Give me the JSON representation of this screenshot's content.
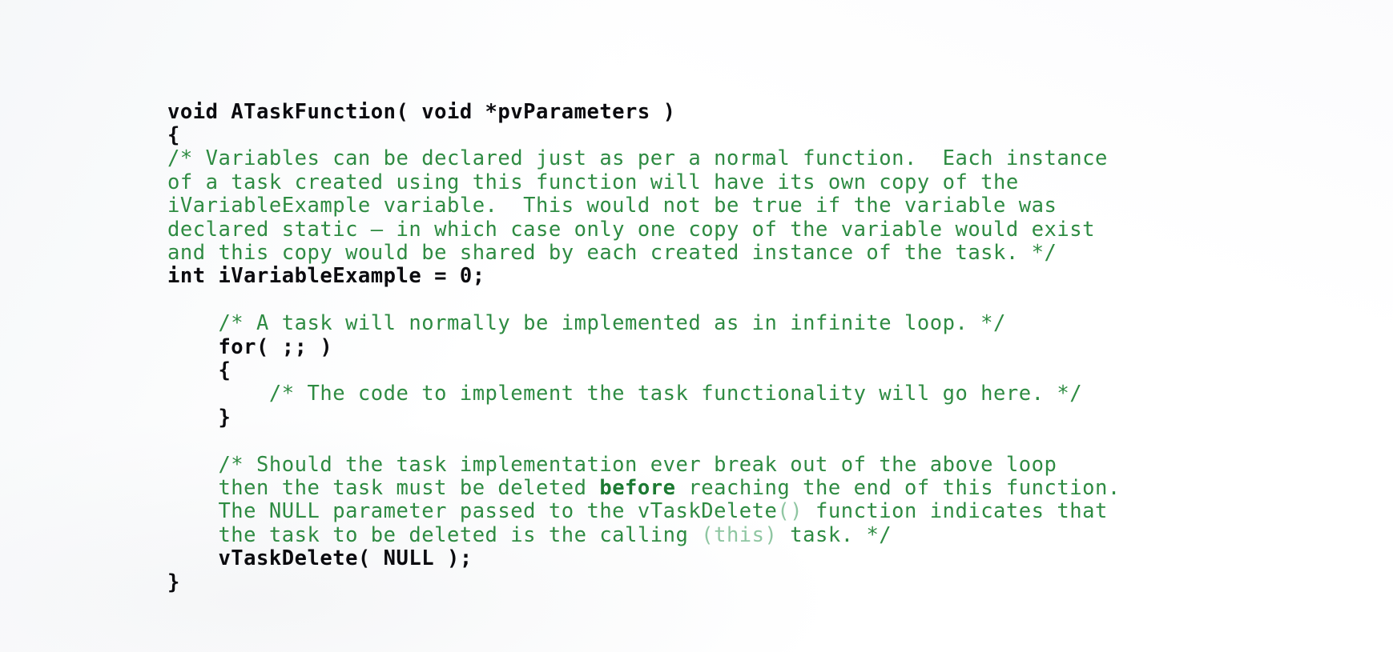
{
  "document": {
    "kind": "code-listing",
    "language": "C",
    "function_name": "ATaskFunction",
    "background_color": "#ffffff",
    "comment_color": "#2e8b42",
    "code_color": "#0b0b0f",
    "dim_comment_color": "#8fc6a2"
  },
  "code": {
    "lines": [
      {
        "id": "line-01",
        "tokens": [
          {
            "kind": "code",
            "text": "void ATaskFunction( void *pvParameters )"
          }
        ]
      },
      {
        "id": "line-02",
        "tokens": [
          {
            "kind": "code",
            "text": "{"
          }
        ]
      },
      {
        "id": "line-03",
        "tokens": [
          {
            "kind": "comment",
            "text": "/* Variables can be declared just as per a normal function.  Each instance"
          }
        ]
      },
      {
        "id": "line-04",
        "tokens": [
          {
            "kind": "comment",
            "text": "of a task created using this function will have its own copy of the"
          }
        ]
      },
      {
        "id": "line-05",
        "tokens": [
          {
            "kind": "comment",
            "text": "iVariableExample variable.  This would not be true if the variable was"
          }
        ]
      },
      {
        "id": "line-06",
        "tokens": [
          {
            "kind": "comment",
            "text": "declared static – in which case only one copy of the variable would exist"
          }
        ]
      },
      {
        "id": "line-07",
        "tokens": [
          {
            "kind": "comment",
            "text": "and this copy would be shared by each created instance of the task. */"
          }
        ]
      },
      {
        "id": "line-08",
        "tokens": [
          {
            "kind": "code",
            "text": "int iVariableExample = 0;"
          }
        ]
      },
      {
        "id": "line-09",
        "tokens": [
          {
            "kind": "blank",
            "text": " "
          }
        ]
      },
      {
        "id": "line-10",
        "tokens": [
          {
            "kind": "comment",
            "text": "    /* A task will normally be implemented as in infinite loop. */"
          }
        ]
      },
      {
        "id": "line-11",
        "tokens": [
          {
            "kind": "code",
            "text": "    for( ;; )"
          }
        ]
      },
      {
        "id": "line-12",
        "tokens": [
          {
            "kind": "code",
            "text": "    {"
          }
        ]
      },
      {
        "id": "line-13",
        "tokens": [
          {
            "kind": "comment",
            "text": "        /* The code to implement the task functionality will go here. */"
          }
        ]
      },
      {
        "id": "line-14",
        "tokens": [
          {
            "kind": "code",
            "text": "    }"
          }
        ]
      },
      {
        "id": "line-15",
        "tokens": [
          {
            "kind": "blank",
            "text": " "
          }
        ]
      },
      {
        "id": "line-16",
        "tokens": [
          {
            "kind": "comment",
            "text": "    /* Should the task implementation ever break out of the above loop"
          }
        ]
      },
      {
        "id": "line-17",
        "tokens": [
          {
            "kind": "comment",
            "text": "    then the task must be deleted "
          },
          {
            "kind": "comment-strong",
            "text": "before"
          },
          {
            "kind": "comment",
            "text": " reaching the end of this function."
          }
        ]
      },
      {
        "id": "line-18",
        "tokens": [
          {
            "kind": "comment",
            "text": "    The NULL parameter passed to the vTaskDelete"
          },
          {
            "kind": "comment-dim",
            "text": "()"
          },
          {
            "kind": "comment",
            "text": " function indicates that"
          }
        ]
      },
      {
        "id": "line-19",
        "tokens": [
          {
            "kind": "comment",
            "text": "    the task to be deleted is the calling "
          },
          {
            "kind": "comment-dim",
            "text": "(this)"
          },
          {
            "kind": "comment",
            "text": " task. */"
          }
        ]
      },
      {
        "id": "line-20",
        "tokens": [
          {
            "kind": "code",
            "text": "    vTaskDelete( NULL );"
          }
        ]
      },
      {
        "id": "line-21",
        "tokens": [
          {
            "kind": "code",
            "text": "}"
          }
        ]
      }
    ]
  }
}
